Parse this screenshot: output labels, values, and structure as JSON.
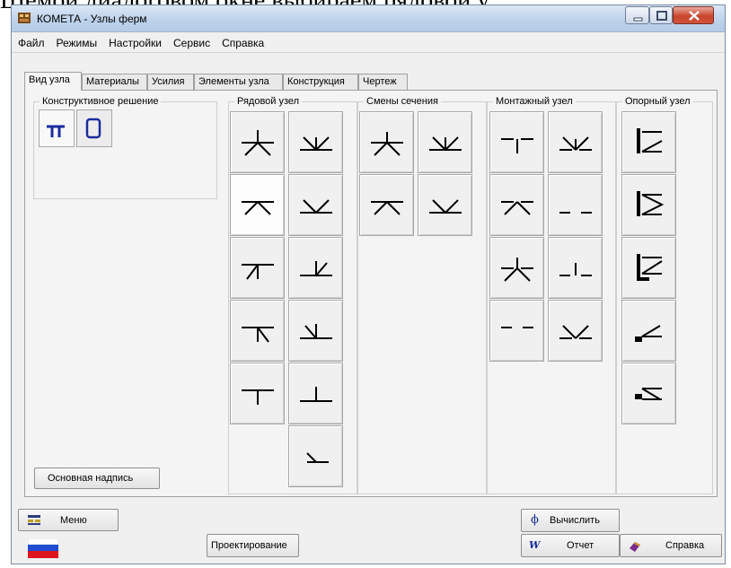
{
  "background_text": "Шемой диалоговом окне выбираем рядовой у",
  "window": {
    "title": "КОМЕТА - Узлы ферм",
    "controls": [
      "minimize",
      "maximize",
      "close"
    ]
  },
  "menu": [
    "Файл",
    "Режимы",
    "Настройки",
    "Сервис",
    "Справка"
  ],
  "tabs": [
    "Вид узла",
    "Материалы",
    "Усилия",
    "Элементы узла",
    "Конструкция",
    "Чертеж"
  ],
  "active_tab": "Вид узла",
  "groups": {
    "construct": "Конструктивное решение",
    "row": "Рядовой узел",
    "section": "Смены сечения",
    "mount": "Монтажный узел",
    "support": "Опорный узел"
  },
  "construct_buttons": [
    "T-profile-icon",
    "tube-profile-icon"
  ],
  "buttons": {
    "main_caption": "Основная надпись",
    "menu": "Меню",
    "design": "Проектирование",
    "calculate": "Вычислить",
    "report": "Отчет",
    "help": "Справка"
  },
  "icons": {
    "menu": "menu-icon",
    "calculate": "phi-icon",
    "report": "w-icon",
    "help": "book-icon",
    "flag": "russian-flag"
  },
  "colors": {
    "accent": "#1a2c9c",
    "flag": [
      "#ffffff",
      "#1f4fd0",
      "#e0141c"
    ]
  }
}
